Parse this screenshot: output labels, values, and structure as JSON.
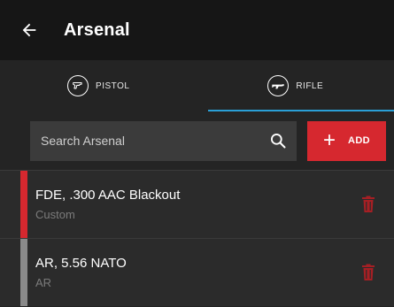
{
  "header": {
    "title": "Arsenal"
  },
  "tabs": [
    {
      "label": "PISTOL",
      "icon": "pistol-icon"
    },
    {
      "label": "RIFLE",
      "icon": "rifle-icon",
      "active": true
    }
  ],
  "search": {
    "placeholder": "Search Arsenal",
    "value": ""
  },
  "add_button": {
    "label": "ADD"
  },
  "items": [
    {
      "name": "FDE, .300 AAC Blackout",
      "subtitle": "Custom",
      "bar_color": "#d6282f"
    },
    {
      "name": "AR, 5.56 NATO",
      "subtitle": "AR",
      "bar_color": "#8a8a8a"
    }
  ],
  "colors": {
    "accent": "#2a9fd6",
    "danger": "#d6282f",
    "trash_icon": "#a61f24"
  }
}
